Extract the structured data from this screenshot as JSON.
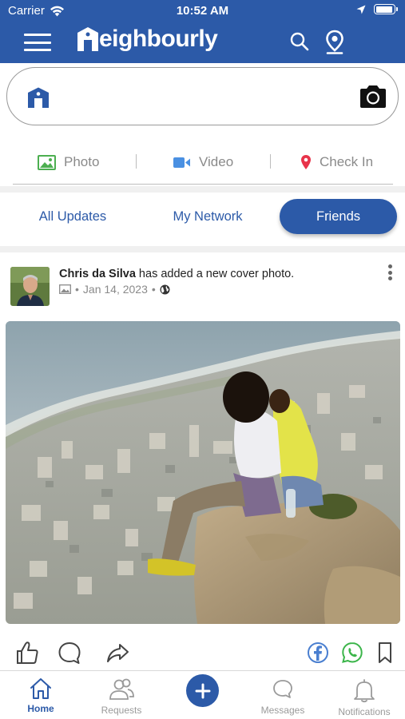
{
  "status_bar": {
    "carrier": "Carrier",
    "time": "10:52 AM",
    "battery_level": 0.95
  },
  "header": {
    "app_name": "eighbourly",
    "brand_color": "#2c5aa8",
    "icons": [
      "menu-icon",
      "search-icon",
      "location-pin-icon"
    ]
  },
  "composer": {
    "icons": [
      "neighbourly-logo-icon",
      "camera-icon"
    ]
  },
  "media_options": [
    {
      "label": "Photo",
      "icon": "photo-icon",
      "color": "#4caf50"
    },
    {
      "label": "Video",
      "icon": "video-icon",
      "color": "#4a90e2"
    },
    {
      "label": "Check In",
      "icon": "map-pin-icon",
      "color": "#e8334a"
    }
  ],
  "feed_tabs": [
    {
      "label": "All Updates",
      "active": false
    },
    {
      "label": "My Network",
      "active": false
    },
    {
      "label": "Friends",
      "active": true
    }
  ],
  "post": {
    "author": "Chris da Silva",
    "action_text": " has added a new cover photo.",
    "date": "Jan 14, 2023",
    "separator": "•",
    "photo_icon": "image-icon",
    "visibility_icon": "globe-icon"
  },
  "post_actions": [
    "like-icon",
    "comment-icon",
    "share-icon",
    "facebook-icon",
    "whatsapp-icon",
    "bookmark-icon"
  ],
  "bottom_nav": [
    {
      "label": "Home",
      "icon": "home-icon",
      "active": true
    },
    {
      "label": "Requests",
      "icon": "people-icon",
      "active": false
    },
    {
      "label": "Messages",
      "icon": "chat-bubble-icon",
      "active": false
    },
    {
      "label": "Notifications",
      "icon": "bell-icon",
      "active": false
    }
  ]
}
